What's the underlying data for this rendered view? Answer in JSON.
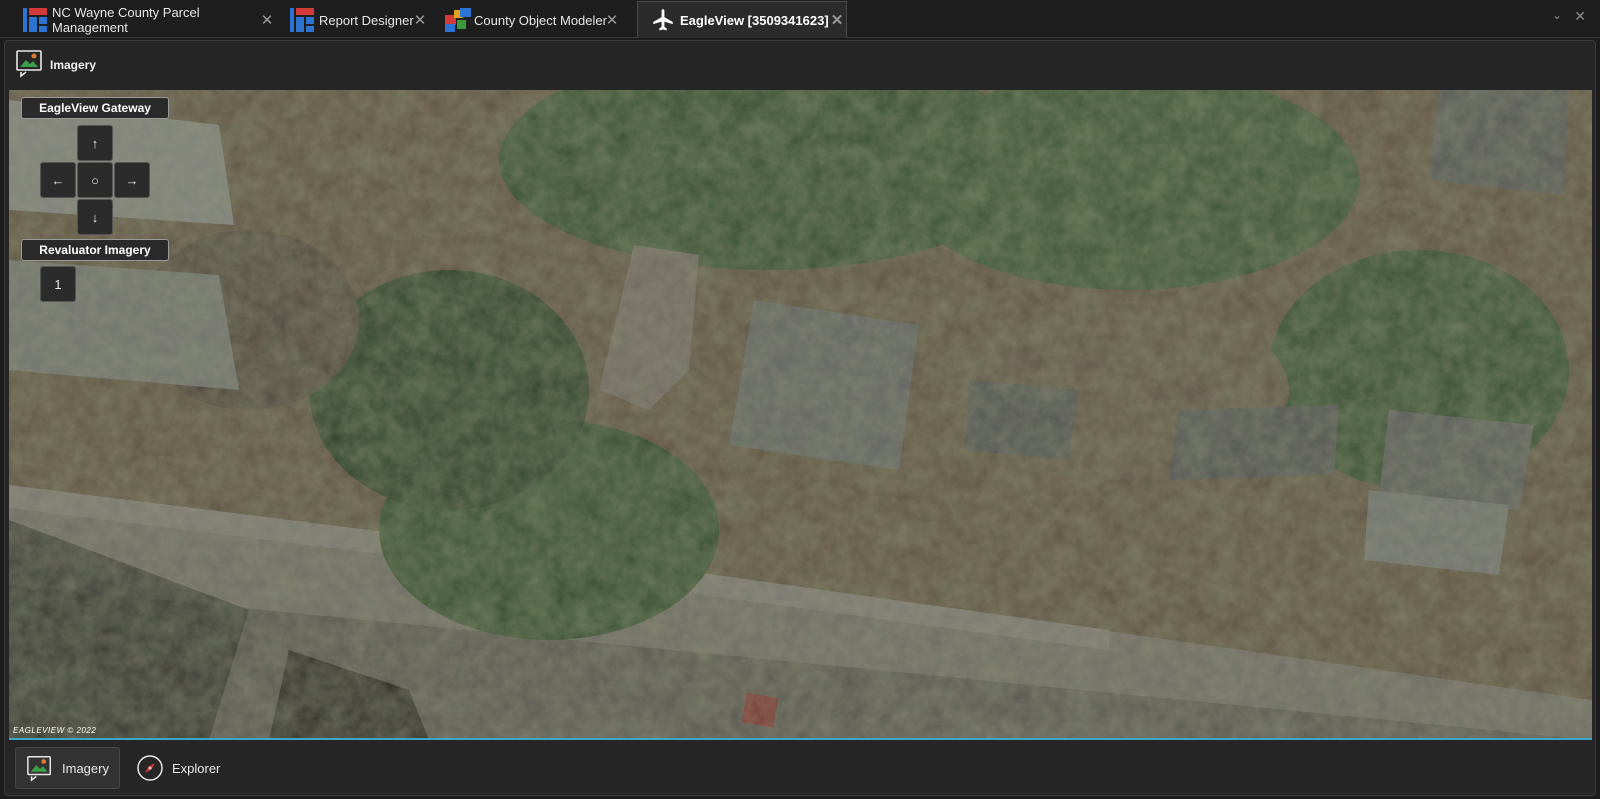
{
  "tabs": [
    {
      "label": "NC Wayne County Parcel Management",
      "icon": "parcel-app-icon",
      "close": "✕"
    },
    {
      "label": "Report Designer",
      "icon": "report-designer-icon",
      "close": "✕"
    },
    {
      "label": "County Object Modeler",
      "icon": "object-modeler-icon",
      "close": "✕"
    },
    {
      "label": "EagleView [3509341623]",
      "icon": "airplane-icon",
      "close": "✕",
      "active": true
    }
  ],
  "window": {
    "chevron": "⌄",
    "close": "✕"
  },
  "panel": {
    "title": "Imagery",
    "icon": "imagery-icon"
  },
  "gateway": {
    "label": "EagleView Gateway",
    "up": "↑",
    "left": "←",
    "center": "○",
    "right": "→",
    "down": "↓"
  },
  "revaluator": {
    "label": "Revaluator Imagery",
    "button": "1"
  },
  "map": {
    "copyright": "EAGLEVIEW © 2022"
  },
  "bottom_tabs": [
    {
      "label": "Imagery",
      "icon": "imagery-icon",
      "active": true
    },
    {
      "label": "Explorer",
      "icon": "compass-icon",
      "active": false
    }
  ],
  "colors": {
    "accent": "#3aa9c8",
    "background": "#1c1c1c",
    "panel": "#262626"
  }
}
